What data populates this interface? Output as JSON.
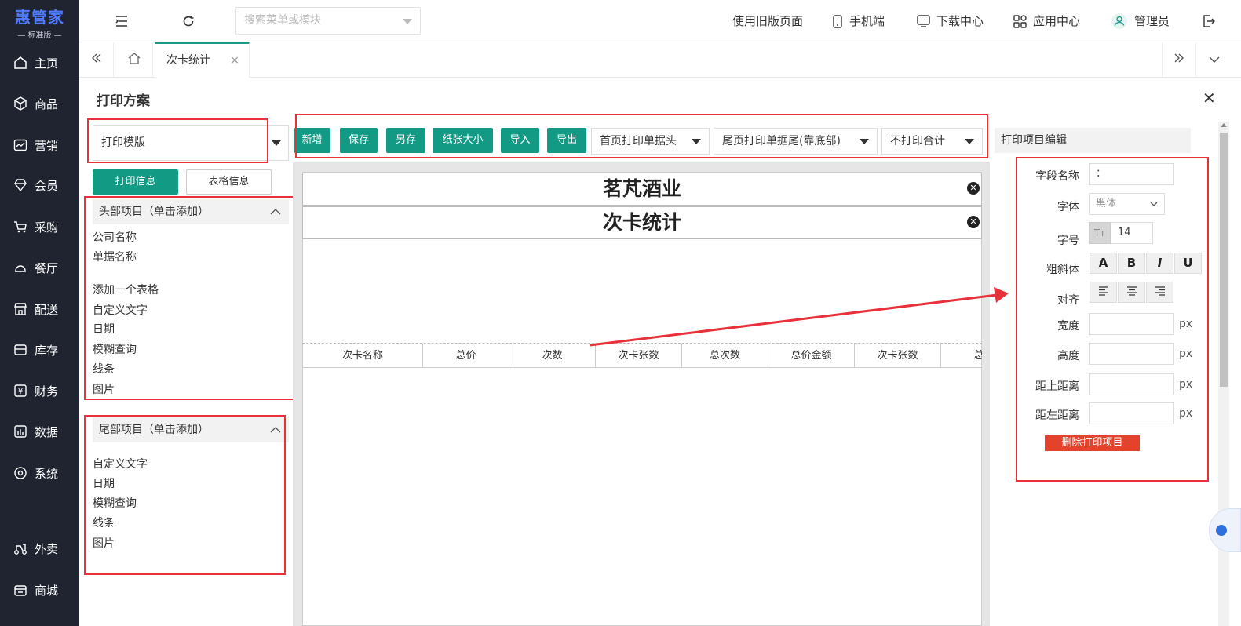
{
  "sidebar": {
    "brand": "惠管家",
    "edition": "— 标准版 —",
    "items": [
      {
        "label": "主页",
        "icon": "home-icon"
      },
      {
        "label": "商品",
        "icon": "box-icon"
      },
      {
        "label": "营销",
        "icon": "chart-icon"
      },
      {
        "label": "会员",
        "icon": "diamond-icon"
      },
      {
        "label": "采购",
        "icon": "cart-icon"
      },
      {
        "label": "餐厅",
        "icon": "cloche-icon"
      },
      {
        "label": "配送",
        "icon": "store-icon"
      },
      {
        "label": "库存",
        "icon": "warehouse-icon"
      },
      {
        "label": "财务",
        "icon": "yen-icon"
      },
      {
        "label": "数据",
        "icon": "bar-chart-icon"
      },
      {
        "label": "系统",
        "icon": "gear-icon"
      },
      {
        "label": "外卖",
        "icon": "scooter-icon"
      },
      {
        "label": "商城",
        "icon": "shop-icon"
      }
    ]
  },
  "topbar": {
    "search_placeholder": "搜索菜单或模块",
    "old_version": "使用旧版页面",
    "mobile": "手机端",
    "download": "下载中心",
    "apps": "应用中心",
    "user": "管理员"
  },
  "tabs": {
    "active": "次卡统计",
    "close": "×"
  },
  "panel": {
    "title": "打印方案",
    "close": "✕",
    "template_select": "打印模版",
    "print_info": "打印信息",
    "table_info": "表格信息"
  },
  "toolbar": {
    "add": "新增",
    "save": "保存",
    "save_as": "另存",
    "paper_size": "纸张大小",
    "import": "导入",
    "export": "导出",
    "header_option": "首页打印单据头",
    "footer_option": "尾页打印单据尾(靠底部)",
    "total_option": "不打印合计"
  },
  "header_section": {
    "title": "头部项目（单击添加）",
    "items": [
      "公司名称",
      "单据名称",
      "添加一个表格",
      "自定义文字",
      "日期",
      "模糊查询",
      "线条",
      "图片"
    ]
  },
  "footer_section": {
    "title": "尾部项目（单击添加）",
    "items": [
      "自定义文字",
      "日期",
      "模糊查询",
      "线条",
      "图片"
    ]
  },
  "canvas": {
    "company": "茗芃酒业",
    "doc_name": "次卡统计",
    "columns": [
      "次卡名称",
      "总价",
      "次数",
      "次卡张数",
      "总次数",
      "总价金额",
      "次卡张数",
      "总次"
    ]
  },
  "editor": {
    "title": "打印项目编辑",
    "field_name_label": "字段名称",
    "field_name_value": "：",
    "font_label": "字体",
    "font_value": "黑体",
    "size_label": "字号",
    "size_value": "14",
    "style_label": "粗斜体",
    "style_buttons": [
      "A",
      "B",
      "I",
      "U"
    ],
    "align_label": "对齐",
    "width_label": "宽度",
    "height_label": "高度",
    "top_label": "距上距离",
    "left_label": "距左距离",
    "unit": "px",
    "delete": "删除打印项目"
  },
  "colors": {
    "sidebar_bg": "#1f2430",
    "brand": "#4f7cff",
    "accent": "#129a85",
    "highlight": "#e8313a",
    "danger": "#e3432d"
  }
}
